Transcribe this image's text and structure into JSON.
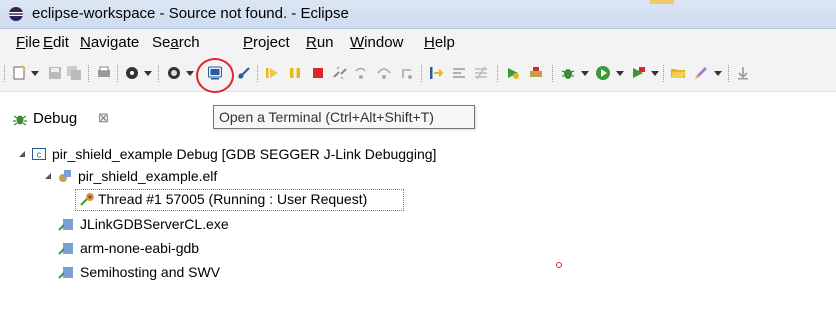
{
  "window": {
    "title": "eclipse-workspace - Source not found. - Eclipse"
  },
  "menubar": {
    "items": [
      {
        "key": "F",
        "rest": "ile"
      },
      {
        "key": "E",
        "rest": "dit"
      },
      {
        "key": "N",
        "rest": "avigate"
      },
      {
        "pre": "Se",
        "key": "a",
        "rest": "rch"
      },
      {
        "key": "P",
        "rest": "roject"
      },
      {
        "key": "R",
        "rest": "un"
      },
      {
        "key": "W",
        "rest": "indow"
      },
      {
        "key": "H",
        "rest": "elp"
      }
    ]
  },
  "tooltip": {
    "text": "Open a Terminal (Ctrl+Alt+Shift+T)"
  },
  "debug_view": {
    "tab_label": "Debug",
    "close_glyph": "⊠"
  },
  "tree": {
    "launch": "pir_shield_example Debug [GDB SEGGER J-Link Debugging]",
    "elf": "pir_shield_example.elf",
    "thread": "Thread #1 57005 (Running : User Request)",
    "processes": [
      "JLinkGDBServerCL.exe",
      "arm-none-eabi-gdb",
      "Semihosting and SWV"
    ]
  },
  "colors": {
    "highlight_circle": "#e0262b",
    "title_bar": "#dbe6f4",
    "terminate_red": "#d9262b",
    "resume_yellow": "#e8b71a"
  },
  "icons": {
    "toolbar": [
      "new-icon",
      "save-icon",
      "save-all-icon",
      "print-icon",
      "target-icon",
      "open-terminal-icon",
      "skip-breakpoints-icon",
      "resume-icon",
      "suspend-icon",
      "terminate-icon",
      "disconnect-icon",
      "step-into-icon",
      "step-over-icon",
      "step-return-icon",
      "instruction-step-icon",
      "drop-to-frame-icon",
      "use-step-filters-icon",
      "debug-config-icon",
      "bug-icon",
      "run-icon",
      "external-tools-icon",
      "open-folder-icon",
      "pen-icon"
    ]
  }
}
